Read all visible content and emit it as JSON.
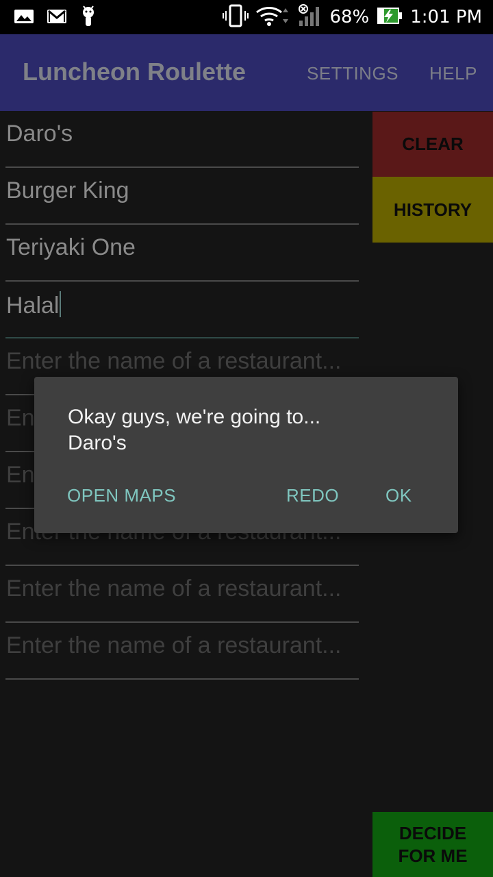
{
  "status_bar": {
    "battery_percent": "68%",
    "time": "1:01 PM",
    "icons": [
      "image-icon",
      "gmail-icon",
      "android-debug-icon",
      "vibrate-icon",
      "wifi-icon",
      "no-signal-icon",
      "battery-charging-icon"
    ]
  },
  "app_bar": {
    "title": "Luncheon Roulette",
    "settings_label": "SETTINGS",
    "help_label": "HELP"
  },
  "restaurants": [
    {
      "value": "Daro's"
    },
    {
      "value": "Burger King"
    },
    {
      "value": "Teriyaki One"
    },
    {
      "value": "Halal"
    }
  ],
  "placeholder": "Enter the name of a restaurant...",
  "side_buttons": {
    "clear": "CLEAR",
    "history": "HISTORY",
    "decide_line1": "DECIDE",
    "decide_line2": "FOR ME"
  },
  "dialog": {
    "line1": "Okay guys, we're going to...",
    "line2": "Daro's",
    "open_maps": "OPEN MAPS",
    "redo": "REDO",
    "ok": "OK"
  },
  "colors": {
    "app_bar": "#2b2a6b",
    "clear": "#5a1818",
    "history": "#6a6200",
    "decide": "#0b5f0b",
    "dialog_accent": "#7fc6bf"
  }
}
